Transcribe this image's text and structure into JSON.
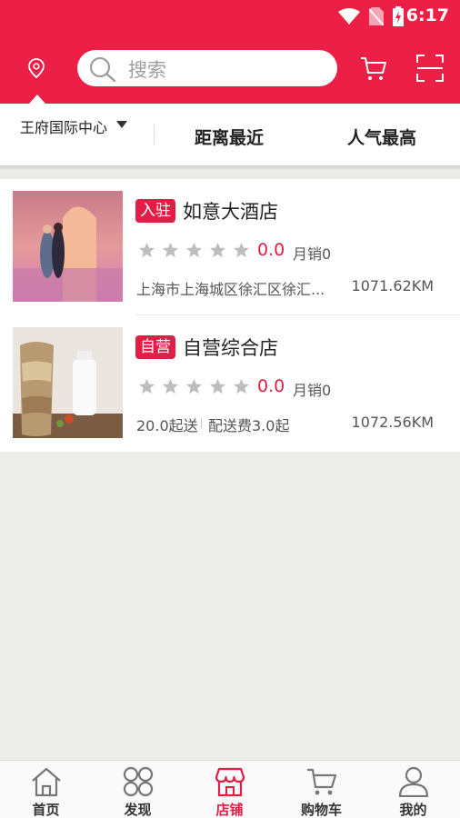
{
  "status_bar": {
    "time": "6:17"
  },
  "header": {
    "search_placeholder": "搜索",
    "accent_color": "#ec1f46"
  },
  "filter": {
    "location": "王府国际中心",
    "sort_distance": "距离最近",
    "sort_popularity": "人气最高"
  },
  "stores": [
    {
      "tag": "入驻",
      "name": "如意大酒店",
      "rating": "0.0",
      "monthly_sales": "月销0",
      "address": "上海市上海城区徐汇区徐汇...",
      "distance": "1071.62KM"
    },
    {
      "tag": "自营",
      "name": "自营综合店",
      "rating": "0.0",
      "monthly_sales": "月销0",
      "min_order": "20.0起送",
      "delivery_fee": "配送费3.0起",
      "distance": "1072.56KM"
    }
  ],
  "bottom_nav": {
    "items": [
      {
        "label": "首页",
        "icon": "home-icon"
      },
      {
        "label": "发现",
        "icon": "discover-icon"
      },
      {
        "label": "店铺",
        "icon": "store-icon",
        "active": true
      },
      {
        "label": "购物车",
        "icon": "cart-icon"
      },
      {
        "label": "我的",
        "icon": "user-icon"
      }
    ]
  }
}
